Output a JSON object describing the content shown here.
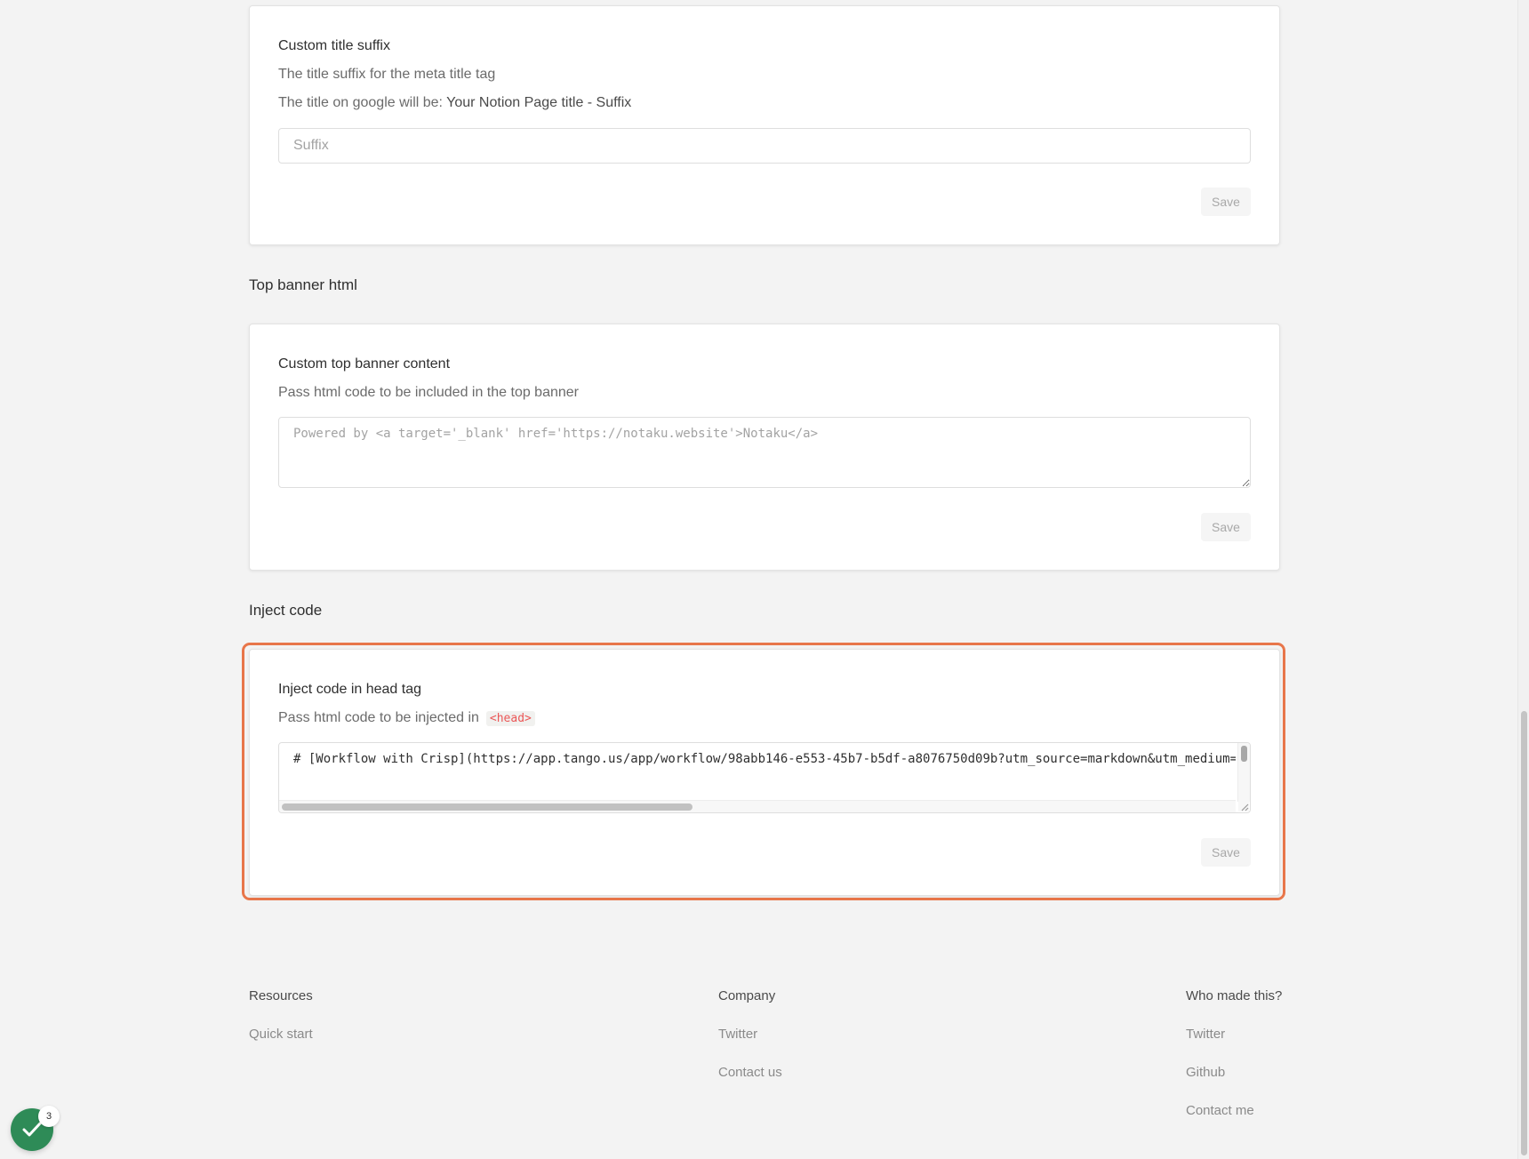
{
  "suffix_card": {
    "title": "Custom title suffix",
    "description": "The title suffix for the meta title tag",
    "google_title_prefix": "The title on google will be: ",
    "google_title_example": "Your Notion Page title - Suffix",
    "input_placeholder": "Suffix",
    "save_label": "Save"
  },
  "top_banner_section": {
    "heading": "Top banner html",
    "card_title": "Custom top banner content",
    "description": "Pass html code to be included in the top banner",
    "textarea_placeholder": "Powered by <a target='_blank' href='https://notaku.website'>Notaku</a>",
    "save_label": "Save"
  },
  "inject_code_section": {
    "heading": "Inject code",
    "card_title": "Inject code in head tag",
    "description": "Pass html code to be injected in",
    "tag_pill": "<head>",
    "code_value": "# [Workflow with Crisp](https://app.tango.us/app/workflow/98abb146-e553-45b7-b5df-a8076750d09b?utm_source=markdown&utm_medium=",
    "save_label": "Save"
  },
  "footer": {
    "resources": {
      "heading": "Resources",
      "links": [
        "Quick start"
      ]
    },
    "company": {
      "heading": "Company",
      "links": [
        "Twitter",
        "Contact us"
      ]
    },
    "who_made": {
      "heading": "Who made this?",
      "links": [
        "Twitter",
        "Github",
        "Contact me"
      ]
    }
  },
  "fab": {
    "badge_count": "3"
  },
  "colors": {
    "highlight": "#e8764a",
    "fab_green": "#2e8b57",
    "pill_text": "#eb5757"
  }
}
